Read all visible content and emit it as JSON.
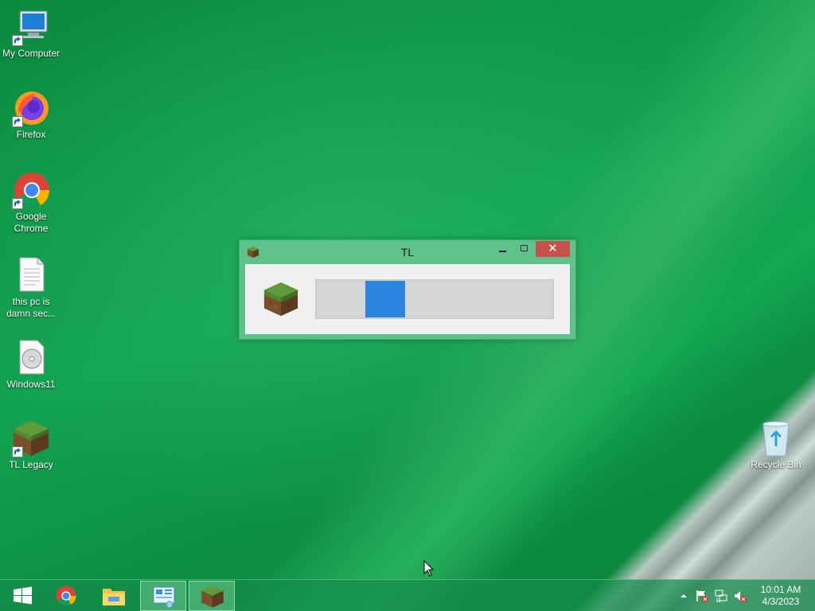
{
  "desktop": {
    "icons": [
      {
        "label": "My Computer",
        "icon": "computer-icon"
      },
      {
        "label": "Firefox",
        "icon": "firefox-icon"
      },
      {
        "label": "Google Chrome",
        "icon": "chrome-icon"
      },
      {
        "label": "this pc is damn sec...",
        "icon": "text-file-icon"
      },
      {
        "label": "Windows11",
        "icon": "disc-image-icon"
      },
      {
        "label": "TL Legacy",
        "icon": "grass-block-icon"
      },
      {
        "label": "Recycle Bin",
        "icon": "recycle-bin-icon"
      }
    ]
  },
  "window": {
    "title": "TL",
    "icon": "grass-block-icon",
    "close_glyph": "✕",
    "progress": {
      "state": "indeterminate",
      "position_fraction": 0.21,
      "color": "#2a86e0"
    }
  },
  "taskbar": {
    "items": [
      {
        "name": "start",
        "icon": "windows-logo-icon"
      },
      {
        "name": "chrome",
        "icon": "chrome-icon"
      },
      {
        "name": "file-explorer",
        "icon": "folder-icon"
      },
      {
        "name": "control-panel",
        "icon": "control-panel-icon",
        "active": true
      },
      {
        "name": "tl-legacy",
        "icon": "grass-block-icon",
        "active": true
      }
    ],
    "tray": {
      "icons": [
        "chevron-up-icon",
        "action-center-flag-icon",
        "network-icon",
        "volume-muted-icon"
      ],
      "time": "10:01 AM",
      "date": "4/3/2023"
    }
  },
  "colors": {
    "wallpaper_green": "#0e9a4a",
    "taskbar": "#148c4b",
    "window_frame": "#5fc28a",
    "close_button": "#c7504a",
    "progress_fill": "#2a86e0"
  }
}
